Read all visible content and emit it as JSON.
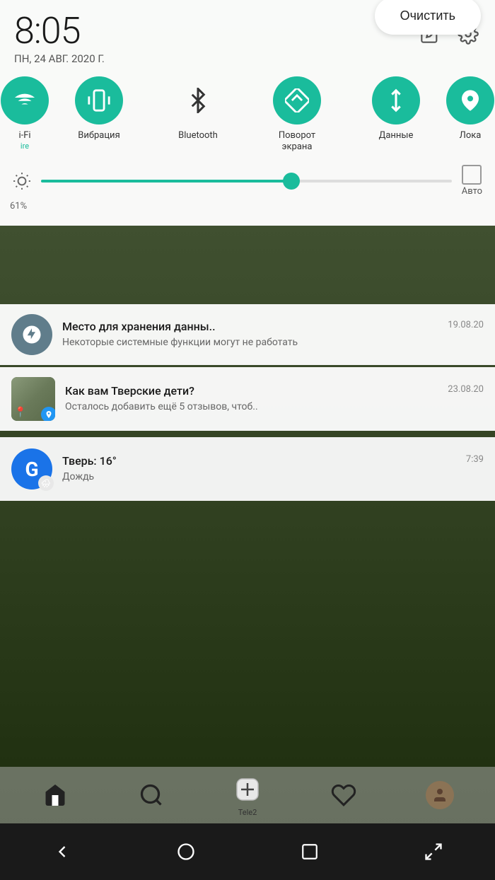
{
  "statusBar": {
    "time": "8:05",
    "date": "ПН, 24 АВГ. 2020 Г."
  },
  "quickToggles": [
    {
      "id": "wifi",
      "label": "i-Fi",
      "active": true,
      "sublabel": "ire"
    },
    {
      "id": "vibration",
      "label": "Вибрация",
      "active": true
    },
    {
      "id": "bluetooth",
      "label": "Bluetooth",
      "active": false
    },
    {
      "id": "rotate",
      "label": "Поворот\nэкрана",
      "active": true
    },
    {
      "id": "data",
      "label": "Данные",
      "active": true
    },
    {
      "id": "location",
      "label": "Лока...",
      "active": true
    }
  ],
  "brightness": {
    "percent": "61%",
    "autoLabel": "Авто"
  },
  "notifications": [
    {
      "id": "storage",
      "title": "Место для хранения данны..",
      "body": "Некоторые системные функции могут не работать",
      "time": "19.08.20"
    },
    {
      "id": "maps",
      "title": "Как вам Тверские дети?",
      "body": "Осталось добавить ещё 5 отзывов, чтоб..",
      "time": "23.08.20"
    },
    {
      "id": "weather",
      "title": "Тверь: 16°",
      "body": "Дождь",
      "time": "7:39"
    }
  ],
  "clearButton": "Очистить",
  "dock": {
    "items": [
      {
        "label": "",
        "icon": "home"
      },
      {
        "label": "",
        "icon": "search"
      },
      {
        "label": "Tele2",
        "icon": "plus-circle"
      },
      {
        "label": "",
        "icon": "heart"
      },
      {
        "label": "",
        "icon": "avatar"
      }
    ]
  },
  "navBar": {
    "back": "◁",
    "home": "○",
    "recents": "□",
    "menu": "⇥"
  }
}
